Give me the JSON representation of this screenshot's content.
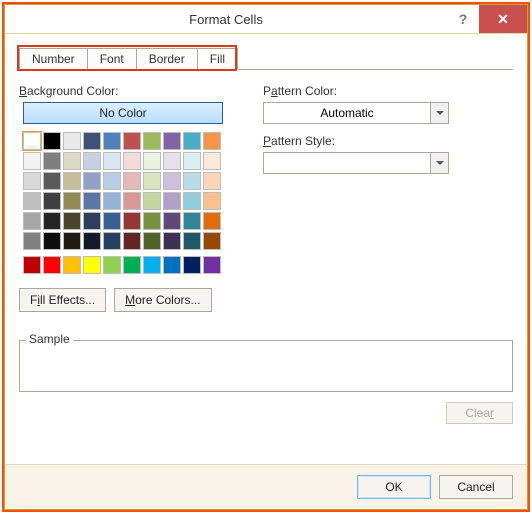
{
  "window": {
    "title": "Format Cells",
    "help": "?",
    "close": "✕"
  },
  "tabs": {
    "items": [
      "Number",
      "Font",
      "Border",
      "Fill"
    ],
    "active": "Fill"
  },
  "left": {
    "backgroundColorLabel": "Background Color:",
    "noColor": "No Color",
    "fillEffects": "Fill Effects...",
    "moreColors": "More Colors...",
    "palette_main": [
      [
        "#ffffff",
        "#000000",
        "#e8e8e8",
        "#3f5176",
        "#4f81bd",
        "#c0504d",
        "#9bbb59",
        "#8064a2",
        "#4bacc6",
        "#f79646"
      ],
      [
        "#f2f2f2",
        "#7f7f7f",
        "#ddd9c3",
        "#c6d0e0",
        "#dbe5f1",
        "#f2dcdb",
        "#ebf1de",
        "#e5e0ec",
        "#dbeef3",
        "#fde9d9"
      ],
      [
        "#d9d9d9",
        "#595959",
        "#c5be97",
        "#8fa2c5",
        "#b8cce4",
        "#e6b9b8",
        "#d7e4bd",
        "#ccc0da",
        "#b7dde8",
        "#fbd5b5"
      ],
      [
        "#bfbfbf",
        "#404040",
        "#948a54",
        "#5b77a6",
        "#95b3d7",
        "#d99795",
        "#c3d69b",
        "#b2a1c7",
        "#92cddc",
        "#fac090"
      ],
      [
        "#a6a6a6",
        "#262626",
        "#4a452a",
        "#2f3f5e",
        "#366092",
        "#963634",
        "#76923c",
        "#5f497a",
        "#31859b",
        "#e26c09"
      ],
      [
        "#808080",
        "#0d0d0d",
        "#1e1c11",
        "#141a27",
        "#244061",
        "#632423",
        "#4f6228",
        "#3f3151",
        "#205867",
        "#974806"
      ]
    ],
    "palette_std": [
      "#c00000",
      "#ff0000",
      "#ffc000",
      "#ffff00",
      "#92d050",
      "#00b050",
      "#00b0f0",
      "#0070c0",
      "#002060",
      "#7030a0"
    ]
  },
  "right": {
    "patternColorLabel": "Pattern Color:",
    "patternColorValue": "Automatic",
    "patternStyleLabel": "Pattern Style:",
    "patternStyleValue": ""
  },
  "sample": {
    "label": "Sample"
  },
  "buttons": {
    "clear": "Clear",
    "ok": "OK",
    "cancel": "Cancel"
  }
}
